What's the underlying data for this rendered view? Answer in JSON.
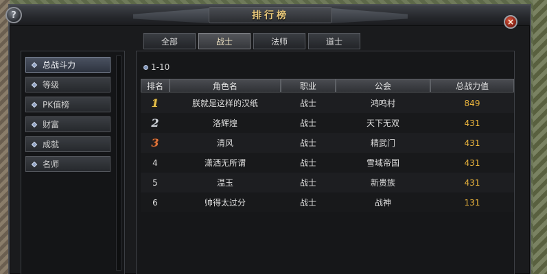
{
  "window": {
    "title": "排行榜",
    "help_glyph": "?",
    "close_glyph": "×"
  },
  "tabs": [
    {
      "label": "全部",
      "active": false
    },
    {
      "label": "战士",
      "active": true
    },
    {
      "label": "法师",
      "active": false
    },
    {
      "label": "道士",
      "active": false
    }
  ],
  "sidebar": {
    "items": [
      {
        "label": "总战斗力",
        "active": true
      },
      {
        "label": "等级",
        "active": false
      },
      {
        "label": "PK值榜",
        "active": false
      },
      {
        "label": "财富",
        "active": false
      },
      {
        "label": "成就",
        "active": false
      },
      {
        "label": "名师",
        "active": false
      }
    ]
  },
  "list": {
    "range_label": "1-10",
    "columns": [
      "排名",
      "角色名",
      "职业",
      "公会",
      "总战力值"
    ],
    "rows": [
      {
        "rank": "1",
        "name": "朕就是这样的汉纸",
        "class": "战士",
        "guild": "鸿鸣村",
        "power": "849"
      },
      {
        "rank": "2",
        "name": "洛辉煌",
        "class": "战士",
        "guild": "天下无双",
        "power": "431"
      },
      {
        "rank": "3",
        "name": "清风",
        "class": "战士",
        "guild": "精武门",
        "power": "431"
      },
      {
        "rank": "4",
        "name": "潇洒无所谓",
        "class": "战士",
        "guild": "雪域帝国",
        "power": "431"
      },
      {
        "rank": "5",
        "name": "温玉",
        "class": "战士",
        "guild": "新贵族",
        "power": "431"
      },
      {
        "rank": "6",
        "name": "帅得太过分",
        "class": "战士",
        "guild": "战神",
        "power": "131"
      }
    ]
  },
  "colors": {
    "title_gold": "#e7c77a",
    "power_gold": "#e9b33c",
    "rank1": "#e8c24a",
    "rank2": "#cfd3d9",
    "rank3": "#e0743a"
  }
}
